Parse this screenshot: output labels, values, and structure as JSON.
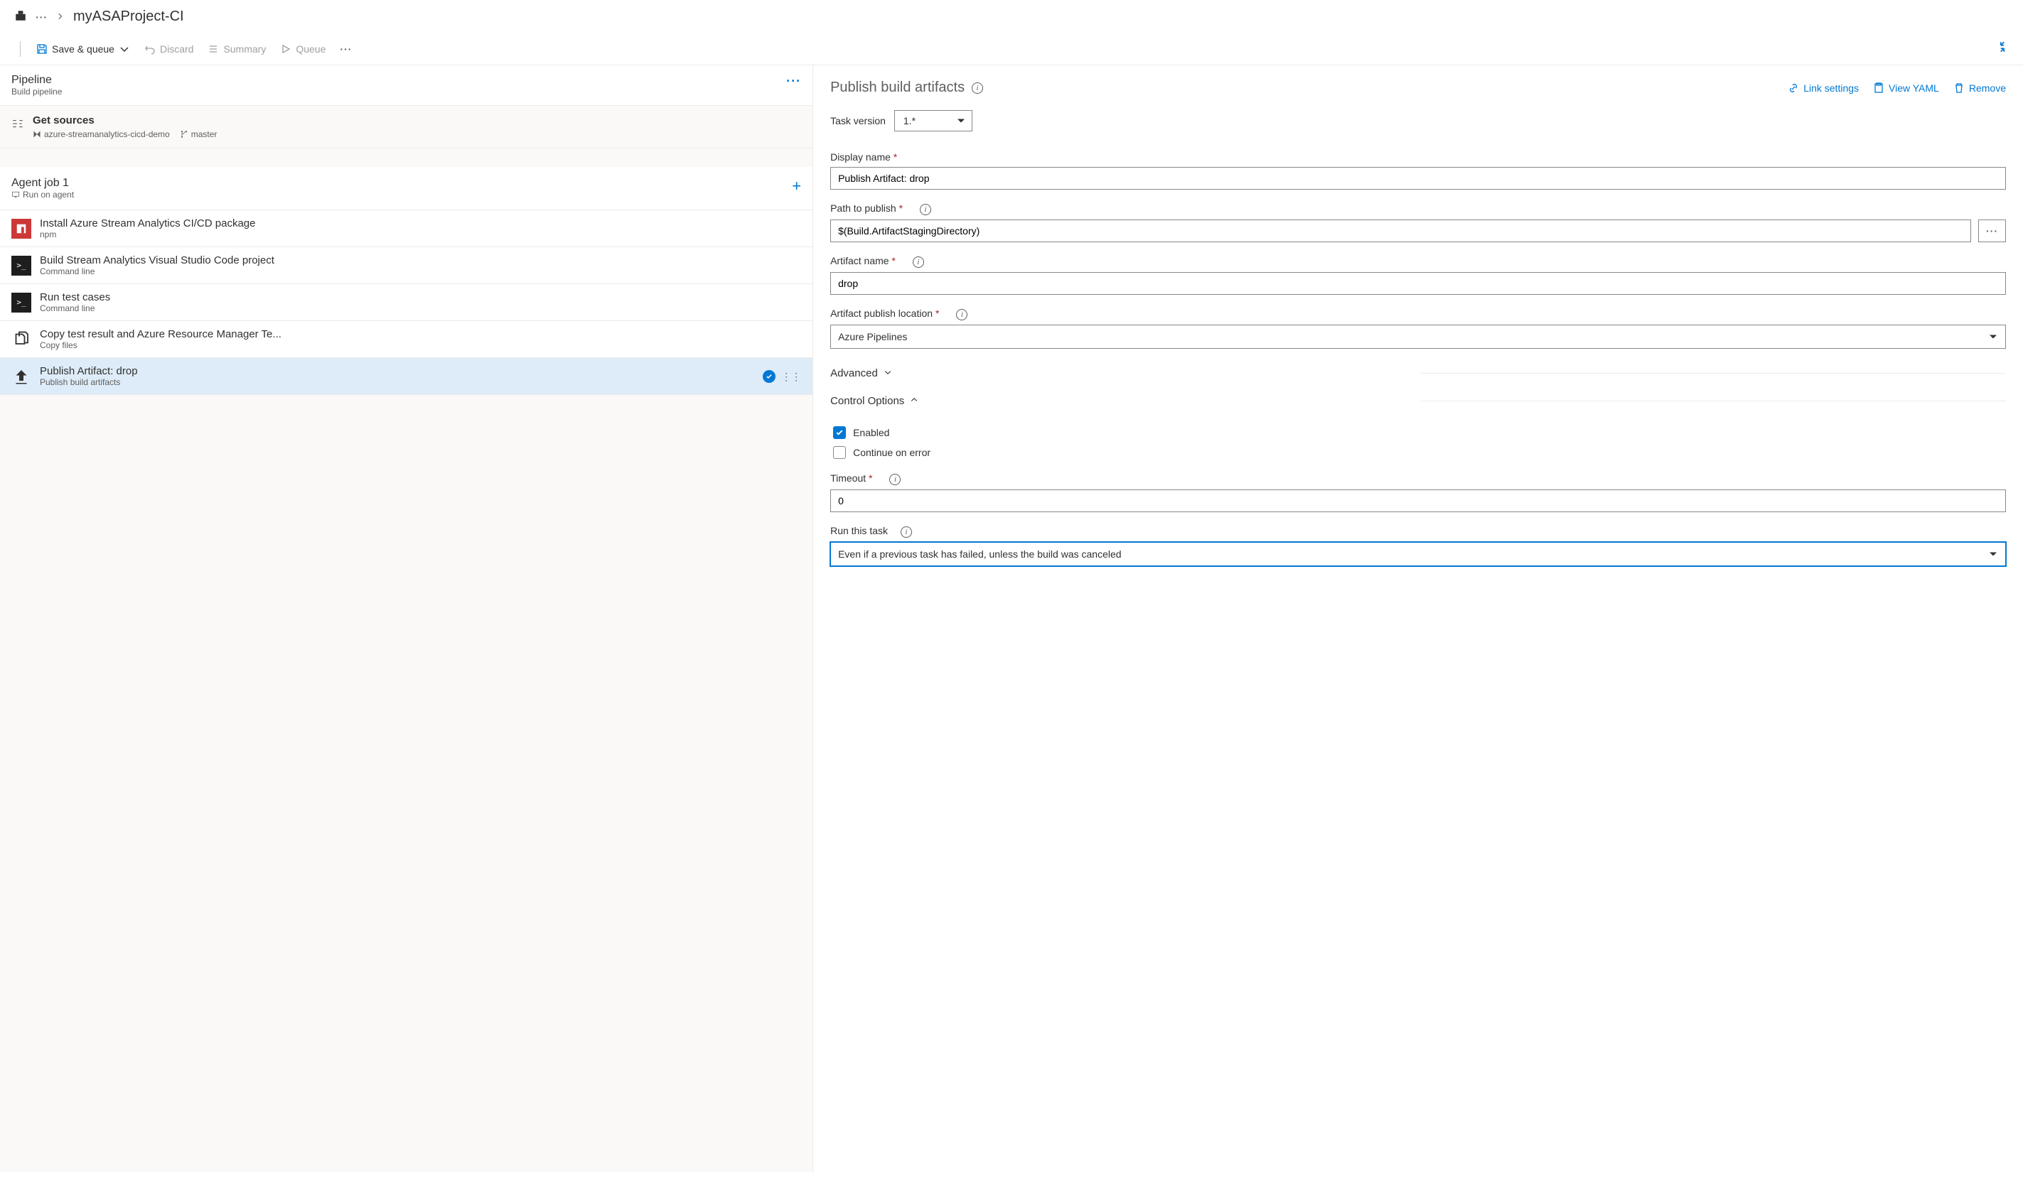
{
  "breadcrumb": {
    "title": "myASAProject-CI"
  },
  "toolbar": {
    "save_queue": "Save & queue",
    "discard": "Discard",
    "summary": "Summary",
    "queue": "Queue"
  },
  "pipeline": {
    "title": "Pipeline",
    "subtitle": "Build pipeline"
  },
  "sources": {
    "title": "Get sources",
    "repo": "azure-streamanalytics-cicd-demo",
    "branch": "master"
  },
  "agent": {
    "title": "Agent job 1",
    "subtitle": "Run on agent"
  },
  "tasks": [
    {
      "title": "Install Azure Stream Analytics CI/CD package",
      "subtitle": "npm",
      "icon": "npm"
    },
    {
      "title": "Build Stream Analytics Visual Studio Code project",
      "subtitle": "Command line",
      "icon": "cmd"
    },
    {
      "title": "Run test cases",
      "subtitle": "Command line",
      "icon": "cmd"
    },
    {
      "title": "Copy test result and Azure Resource Manager Te...",
      "subtitle": "Copy files",
      "icon": "copy"
    },
    {
      "title": "Publish Artifact: drop",
      "subtitle": "Publish build artifacts",
      "icon": "upload",
      "selected": true
    }
  ],
  "detail": {
    "title": "Publish build artifacts",
    "actions": {
      "link_settings": "Link settings",
      "view_yaml": "View YAML",
      "remove": "Remove"
    },
    "task_version_label": "Task version",
    "task_version_value": "1.*",
    "display_name_label": "Display name",
    "display_name_value": "Publish Artifact: drop",
    "path_label": "Path to publish",
    "path_value": "$(Build.ArtifactStagingDirectory)",
    "artifact_name_label": "Artifact name",
    "artifact_name_value": "drop",
    "publish_location_label": "Artifact publish location",
    "publish_location_value": "Azure Pipelines",
    "advanced_label": "Advanced",
    "control_options_label": "Control Options",
    "enabled_label": "Enabled",
    "continue_label": "Continue on error",
    "timeout_label": "Timeout",
    "timeout_value": "0",
    "run_task_label": "Run this task",
    "run_task_value": "Even if a previous task has failed, unless the build was canceled"
  }
}
